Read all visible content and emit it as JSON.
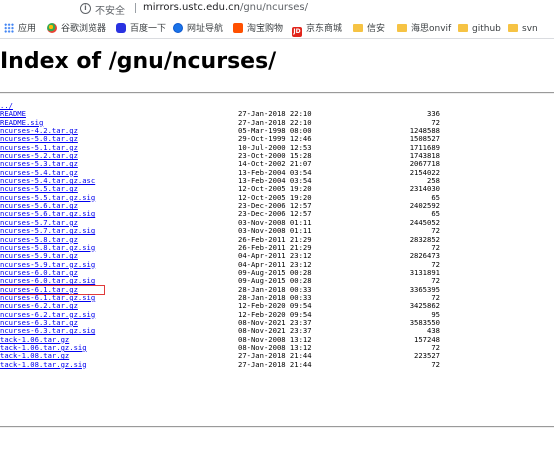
{
  "browser": {
    "security_label": "不安全",
    "url_host": "mirrors.ustc.edu.cn",
    "url_path": "/gnu/ncurses/"
  },
  "bookmarks": [
    {
      "label": "应用",
      "icon": "apps-icon"
    },
    {
      "label": "谷歌浏览器",
      "icon": "chrome-icon"
    },
    {
      "label": "百度一下",
      "icon": "baidu-icon"
    },
    {
      "label": "网址导航",
      "icon": "globe-icon"
    },
    {
      "label": "淘宝购物",
      "icon": "taobao-icon"
    },
    {
      "label": "京东商城",
      "icon": "jd-icon",
      "icon_text": "JD"
    },
    {
      "label": "信安",
      "icon": "folder-icon"
    },
    {
      "label": "海思onvif",
      "icon": "folder-icon"
    },
    {
      "label": "github",
      "icon": "folder-icon"
    },
    {
      "label": "svn",
      "icon": "folder-icon"
    }
  ],
  "page": {
    "title": "Index of /gnu/ncurses/",
    "entries": [
      {
        "name": "../",
        "date": "",
        "size": ""
      },
      {
        "name": "README",
        "date": "27-Jan-2018 22:10",
        "size": "336"
      },
      {
        "name": "README.sig",
        "date": "27-Jan-2018 22:10",
        "size": "72"
      },
      {
        "name": "ncurses-4.2.tar.gz",
        "date": "05-Mar-1998 08:00",
        "size": "1248588"
      },
      {
        "name": "ncurses-5.0.tar.gz",
        "date": "29-Oct-1999 12:46",
        "size": "1508527"
      },
      {
        "name": "ncurses-5.1.tar.gz",
        "date": "10-Jul-2000 12:53",
        "size": "1711689"
      },
      {
        "name": "ncurses-5.2.tar.gz",
        "date": "23-Oct-2000 15:28",
        "size": "1743818"
      },
      {
        "name": "ncurses-5.3.tar.gz",
        "date": "14-Oct-2002 21:07",
        "size": "2067718"
      },
      {
        "name": "ncurses-5.4.tar.gz",
        "date": "13-Feb-2004 03:54",
        "size": "2154022"
      },
      {
        "name": "ncurses-5.4.tar.gz.asc",
        "date": "13-Feb-2004 03:54",
        "size": "258"
      },
      {
        "name": "ncurses-5.5.tar.gz",
        "date": "12-Oct-2005 19:20",
        "size": "2314030"
      },
      {
        "name": "ncurses-5.5.tar.gz.sig",
        "date": "12-Oct-2005 19:20",
        "size": "65"
      },
      {
        "name": "ncurses-5.6.tar.gz",
        "date": "23-Dec-2006 12:57",
        "size": "2402592"
      },
      {
        "name": "ncurses-5.6.tar.gz.sig",
        "date": "23-Dec-2006 12:57",
        "size": "65"
      },
      {
        "name": "ncurses-5.7.tar.gz",
        "date": "03-Nov-2008 01:11",
        "size": "2445052"
      },
      {
        "name": "ncurses-5.7.tar.gz.sig",
        "date": "03-Nov-2008 01:11",
        "size": "72"
      },
      {
        "name": "ncurses-5.8.tar.gz",
        "date": "26-Feb-2011 21:29",
        "size": "2832852"
      },
      {
        "name": "ncurses-5.8.tar.gz.sig",
        "date": "26-Feb-2011 21:29",
        "size": "72"
      },
      {
        "name": "ncurses-5.9.tar.gz",
        "date": "04-Apr-2011 23:12",
        "size": "2826473"
      },
      {
        "name": "ncurses-5.9.tar.gz.sig",
        "date": "04-Apr-2011 23:12",
        "size": "72"
      },
      {
        "name": "ncurses-6.0.tar.gz",
        "date": "09-Aug-2015 00:28",
        "size": "3131891"
      },
      {
        "name": "ncurses-6.0.tar.gz.sig",
        "date": "09-Aug-2015 00:28",
        "size": "72"
      },
      {
        "name": "ncurses-6.1.tar.gz",
        "date": "28-Jan-2018 00:33",
        "size": "3365395"
      },
      {
        "name": "ncurses-6.1.tar.gz.sig",
        "date": "28-Jan-2018 00:33",
        "size": "72"
      },
      {
        "name": "ncurses-6.2.tar.gz",
        "date": "12-Feb-2020 09:54",
        "size": "3425862"
      },
      {
        "name": "ncurses-6.2.tar.gz.sig",
        "date": "12-Feb-2020 09:54",
        "size": "95"
      },
      {
        "name": "ncurses-6.3.tar.gz",
        "date": "08-Nov-2021 23:37",
        "size": "3583550"
      },
      {
        "name": "ncurses-6.3.tar.gz.sig",
        "date": "08-Nov-2021 23:37",
        "size": "438"
      },
      {
        "name": "tack-1.06.tar.gz",
        "date": "08-Nov-2008 13:12",
        "size": "157248"
      },
      {
        "name": "tack-1.06.tar.gz.sig",
        "date": "08-Nov-2008 13:12",
        "size": "72"
      },
      {
        "name": "tack-1.08.tar.gz",
        "date": "27-Jan-2018 21:44",
        "size": "223527"
      },
      {
        "name": "tack-1.08.tar.gz.sig",
        "date": "27-Jan-2018 21:44",
        "size": "72"
      }
    ],
    "highlight_color": "#e03a3a",
    "link_color": "#0000ee"
  }
}
